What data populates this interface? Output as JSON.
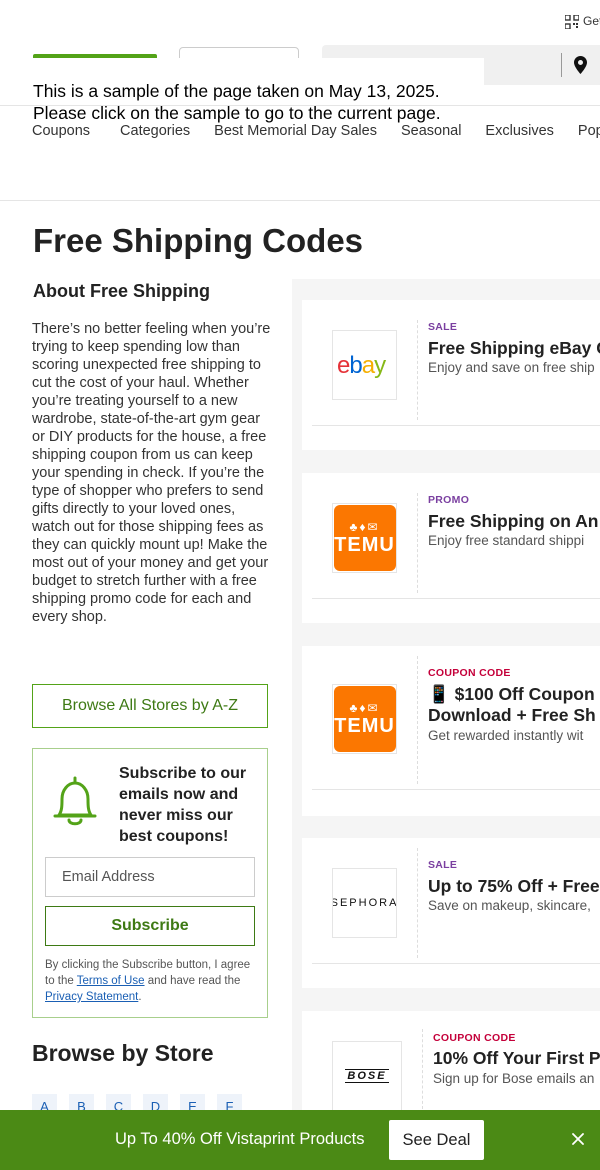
{
  "header": {
    "get_app": "Get",
    "sample_note_line1": "This is a sample of the page taken on May 13, 2025.",
    "sample_note_line2": "Please click on the sample to go to the current page."
  },
  "nav": {
    "items": [
      "Coupons",
      "Categories",
      "Best Memorial Day Sales",
      "Seasonal",
      "Exclusives",
      "Popul"
    ]
  },
  "page": {
    "title": "Free Shipping Codes"
  },
  "about": {
    "title": "About Free Shipping",
    "text": "There’s no better feeling when you’re trying to keep spending low than scoring unexpected free shipping to cut the cost of your haul. Whether you’re treating yourself to a new wardrobe, state-of-the-art gym gear or DIY products for the house, a free shipping coupon from us can keep your spending in check. If you’re the type of shopper who prefers to send gifts directly to your loved ones, watch out for those shipping fees as they can quickly mount up! Make the most out of your money and get your budget to stretch further with a free shipping promo code for each and every shop."
  },
  "browse_all": {
    "label": "Browse All Stores by A-Z"
  },
  "subscribe": {
    "title": "Subscribe to our emails now and never miss our best coupons!",
    "email_placeholder": "Email Address",
    "button": "Subscribe",
    "legal_prefix": "By clicking the Subscribe button, I agree to the ",
    "terms": "Terms of Use",
    "legal_mid": " and have read the ",
    "privacy": "Privacy Statement",
    "legal_suffix": "."
  },
  "browse_store": {
    "title": "Browse by Store",
    "letters": [
      "A",
      "B",
      "C",
      "D",
      "E",
      "F"
    ]
  },
  "offers": [
    {
      "type": "SALE",
      "logo": "ebay",
      "title": "Free Shipping eBay C",
      "desc": "Enjoy and save on free ship"
    },
    {
      "type": "PROMO",
      "logo": "TEMU",
      "title": "Free Shipping on An",
      "desc": "Enjoy free standard shippi"
    },
    {
      "type": "COUPON CODE",
      "logo": "TEMU",
      "title": "📱 $100 Off Coupon",
      "title2": "Download + Free Sh",
      "desc": "Get rewarded instantly wit"
    },
    {
      "type": "SALE",
      "logo": "SEPHORA",
      "title": "Up to 75% Off + Free",
      "desc": "Save on makeup, skincare,"
    },
    {
      "type": "COUPON CODE",
      "logo": "BOSE",
      "title": "10% Off Your First P",
      "desc": "Sign up for Bose emails an"
    }
  ],
  "bottom_banner": {
    "text": "Up To 40% Off Vistaprint Products",
    "button": "See Deal"
  },
  "colors": {
    "brand_green": "#53a318",
    "banner_green": "#4b8a15",
    "sale_purple": "#7a3fa0",
    "code_red": "#c4003a",
    "temu_orange": "#fb7701"
  }
}
